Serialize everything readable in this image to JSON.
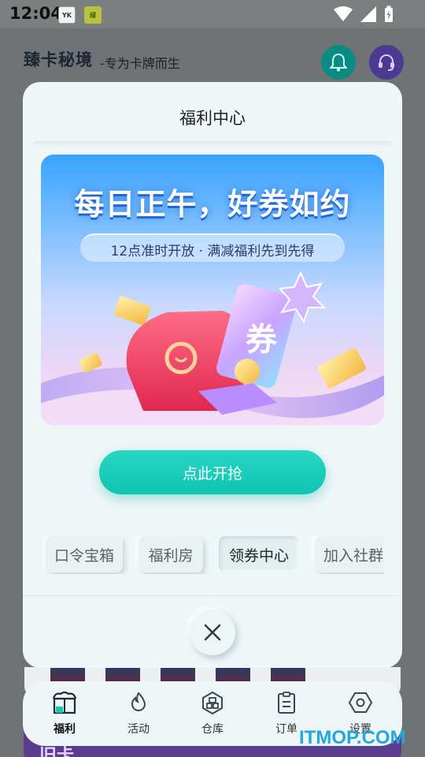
{
  "status_bar": {
    "time": "12:04",
    "badges": [
      "YK",
      "绿"
    ]
  },
  "header": {
    "logo": "臻卡秘境",
    "slogan": "-专为卡牌而生"
  },
  "modal": {
    "title": "福利中心",
    "banner": {
      "headline": "每日正午，好券如约",
      "subline": "12点准时开放 · 满减福利先到先得",
      "coupon_text": "券"
    },
    "action_button": "点此开抢",
    "tabs": [
      {
        "label": "口令宝箱",
        "active": false
      },
      {
        "label": "福利房",
        "active": false
      },
      {
        "label": "领券中心",
        "active": true
      },
      {
        "label": "加入社群",
        "active": false
      }
    ]
  },
  "bottom_nav": [
    {
      "label": "福利",
      "icon": "gift-box-icon",
      "active": true
    },
    {
      "label": "活动",
      "icon": "fire-icon",
      "active": false
    },
    {
      "label": "仓库",
      "icon": "warehouse-icon",
      "active": false
    },
    {
      "label": "订单",
      "icon": "order-clipboard-icon",
      "active": false
    },
    {
      "label": "设置",
      "icon": "gear-hexagon-icon",
      "active": false
    }
  ],
  "background_banner_text": "旧卡",
  "watermark": "ITMOP.COM",
  "colors": {
    "accent": "#14c9b5",
    "modal_bg": "#eef6f8",
    "nav_bg": "#eef5f7"
  }
}
